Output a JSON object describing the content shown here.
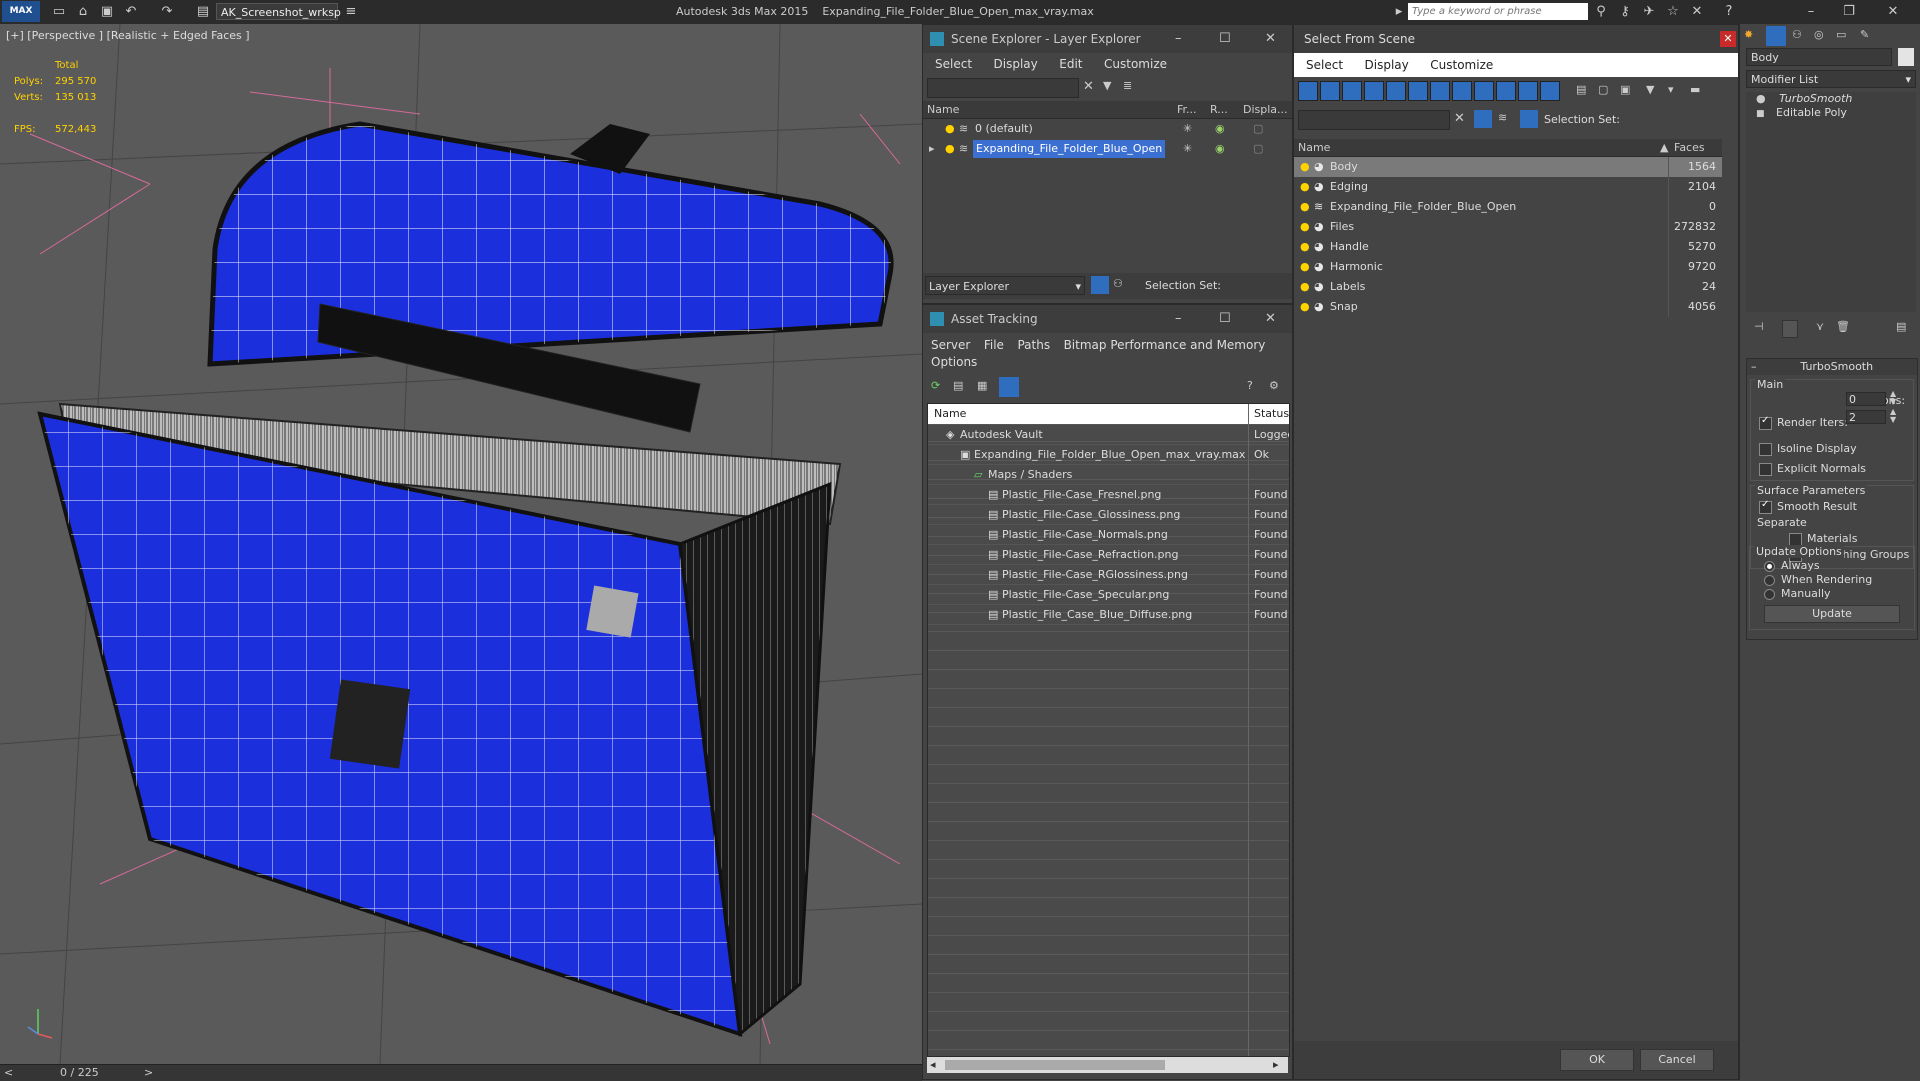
{
  "titlebar": {
    "workspace": "AK_Screenshot_wrksp",
    "app_name": "Autodesk 3ds Max  2015",
    "file_name": "Expanding_File_Folder_Blue_Open_max_vray.max",
    "search_placeholder": "Type a keyword or phrase"
  },
  "viewport": {
    "label": "[+] [Perspective ] [Realistic + Edged Faces ]",
    "stats": {
      "total_label": "Total",
      "polys_label": "Polys:",
      "polys_value": "295 570",
      "verts_label": "Verts:",
      "verts_value": "135 013",
      "fps_label": "FPS:",
      "fps_value": "572,443"
    },
    "timeline": {
      "frame": "0 / 225",
      "prev": "<",
      "next": ">"
    }
  },
  "scene_explorer": {
    "title": "Scene Explorer - Layer Explorer",
    "menu": [
      "Select",
      "Display",
      "Edit",
      "Customize"
    ],
    "columns": [
      "Name",
      "Fr...",
      "R...",
      "Displa..."
    ],
    "rows": [
      {
        "name": "0 (default)",
        "selected": false
      },
      {
        "name": "Expanding_File_Folder_Blue_Open",
        "selected": true
      }
    ],
    "footer_dropdown": "Layer Explorer",
    "selection_set_label": "Selection Set:"
  },
  "asset_tracking": {
    "title": "Asset Tracking",
    "menu": [
      "Server",
      "File",
      "Paths",
      "Bitmap Performance and Memory",
      "Options"
    ],
    "columns": [
      "Name",
      "Status"
    ],
    "rows": [
      {
        "name": "Autodesk Vault",
        "status": "Logged",
        "indent": 0
      },
      {
        "name": "Expanding_File_Folder_Blue_Open_max_vray.max",
        "status": "Ok",
        "indent": 1
      },
      {
        "name": "Maps / Shaders",
        "status": "",
        "indent": 2
      },
      {
        "name": "Plastic_File-Case_Fresnel.png",
        "status": "Found",
        "indent": 3
      },
      {
        "name": "Plastic_File-Case_Glossiness.png",
        "status": "Found",
        "indent": 3
      },
      {
        "name": "Plastic_File-Case_Normals.png",
        "status": "Found",
        "indent": 3
      },
      {
        "name": "Plastic_File-Case_Refraction.png",
        "status": "Found",
        "indent": 3
      },
      {
        "name": "Plastic_File-Case_RGlossiness.png",
        "status": "Found",
        "indent": 3
      },
      {
        "name": "Plastic_File-Case_Specular.png",
        "status": "Found",
        "indent": 3
      },
      {
        "name": "Plastic_File_Case_Blue_Diffuse.png",
        "status": "Found",
        "indent": 3
      }
    ]
  },
  "select_from_scene": {
    "title": "Select From Scene",
    "menu": [
      "Select",
      "Display",
      "Customize"
    ],
    "selection_set_label": "Selection Set:",
    "columns": [
      "Name",
      "Faces"
    ],
    "rows": [
      {
        "name": "Body",
        "faces": "1564",
        "selected": true
      },
      {
        "name": "Edging",
        "faces": "2104",
        "selected": false
      },
      {
        "name": "Expanding_File_Folder_Blue_Open",
        "faces": "0",
        "selected": false
      },
      {
        "name": "Files",
        "faces": "272832",
        "selected": false
      },
      {
        "name": "Handle",
        "faces": "5270",
        "selected": false
      },
      {
        "name": "Harmonic",
        "faces": "9720",
        "selected": false
      },
      {
        "name": "Labels",
        "faces": "24",
        "selected": false
      },
      {
        "name": "Snap",
        "faces": "4056",
        "selected": false
      }
    ],
    "ok_label": "OK",
    "cancel_label": "Cancel"
  },
  "command_panel": {
    "object_name": "Body",
    "modifier_list_label": "Modifier List",
    "stack": [
      "TurboSmooth",
      "Editable Poly"
    ],
    "rollout_title": "TurboSmooth",
    "main_label": "Main",
    "iterations_label": "Iterations:",
    "iterations_value": "0",
    "render_iters_label": "Render Iters:",
    "render_iters_value": "2",
    "render_iters_checked": true,
    "isoline_label": "Isoline Display",
    "explicit_normals_label": "Explicit Normals",
    "surface_params_label": "Surface Parameters",
    "smooth_result_label": "Smooth Result",
    "separate_label": "Separate",
    "materials_label": "Materials",
    "smoothing_groups_label": "Smoothing Groups",
    "update_options_label": "Update Options",
    "update_always": "Always",
    "update_rendering": "When Rendering",
    "update_manually": "Manually",
    "update_button": "Update"
  },
  "colors": {
    "accent_blue": "#2f6dbf",
    "selection_blue": "#3b6fd1",
    "stats_yellow": "#ffd200",
    "model_blue": "#1c2fdc"
  }
}
